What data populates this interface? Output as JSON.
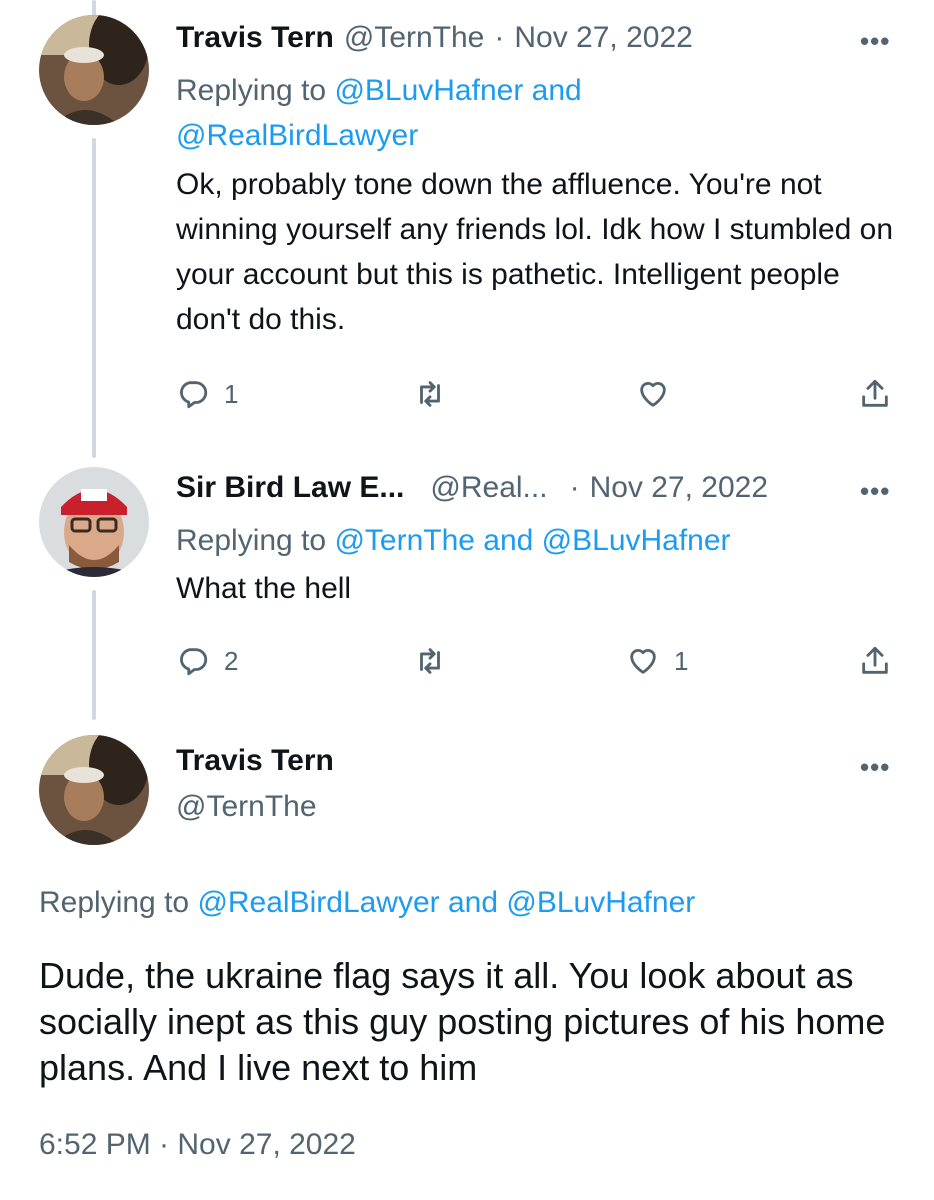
{
  "tweets": [
    {
      "name": "Travis Tern",
      "handle": "@TernThe",
      "sep": "·",
      "date": "Nov 27, 2022",
      "replying_prefix": "Replying to",
      "reply_users_line1": "@BLuvHafner and",
      "reply_users_line2": "@RealBirdLawyer",
      "text": "Ok, probably tone down the affluence. You're not winning yourself any friends lol. Idk how I stumbled on your account but this is pathetic. Intelligent people don't do this.",
      "reply_count": "1",
      "retweet_count": "",
      "like_count": ""
    },
    {
      "name": "Sir Bird Law E...",
      "handle": "@Real...",
      "sep": "·",
      "date": "Nov 27, 2022",
      "replying_prefix": "Replying to",
      "reply_users": "@TernThe and @BLuvHafner",
      "text": "What the hell",
      "reply_count": "2",
      "retweet_count": "",
      "like_count": "1"
    }
  ],
  "main_tweet": {
    "name": "Travis Tern",
    "handle": "@TernThe",
    "replying_prefix": "Replying to",
    "reply_users": "@RealBirdLawyer and @BLuvHafner",
    "text": "Dude, the ukraine flag says it all. You look about as socially inept as this guy posting pictures of his home plans. And I live next to him",
    "timestamp": "6:52 PM · Nov 27, 2022"
  },
  "more_glyph": "•••",
  "colors": {
    "link": "#1d9bf0",
    "secondary": "#536471",
    "thread_line": "#cfd9de",
    "text": "#0f1419"
  },
  "icons": {
    "reply": "reply-icon",
    "retweet": "retweet-icon",
    "like": "heart-icon",
    "share": "share-icon",
    "more": "more-icon"
  }
}
